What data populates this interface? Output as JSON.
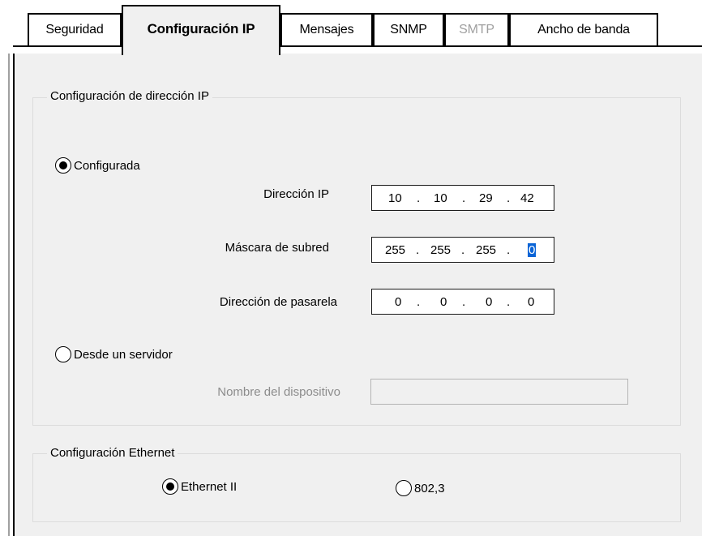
{
  "tabs": [
    {
      "label": "Seguridad",
      "active": false,
      "disabled": false
    },
    {
      "label": "Configuración IP",
      "active": true,
      "disabled": false
    },
    {
      "label": "Mensajes",
      "active": false,
      "disabled": false
    },
    {
      "label": "SNMP",
      "active": false,
      "disabled": false
    },
    {
      "label": "SMTP",
      "active": false,
      "disabled": true
    },
    {
      "label": "Ancho de banda",
      "active": false,
      "disabled": false
    }
  ],
  "ip_group": {
    "title": "Configuración de dirección IP",
    "radio_configured": {
      "label": "Configurada",
      "checked": true
    },
    "radio_server": {
      "label": "Desde un servidor",
      "checked": false
    },
    "ip_address": {
      "label": "Dirección IP",
      "octets": [
        "10",
        "10",
        "29",
        "42"
      ]
    },
    "subnet_mask": {
      "label": "Máscara de subred",
      "octets": [
        "255",
        "255",
        "255",
        "0"
      ],
      "selected_octet": 3
    },
    "gateway": {
      "label": "Dirección de pasarela",
      "octets": [
        "0",
        "0",
        "0",
        "0"
      ]
    },
    "device_name": {
      "label": "Nombre del dispositivo",
      "value": ""
    }
  },
  "ethernet_group": {
    "title": "Configuración Ethernet",
    "radio_ethernet2": {
      "label": "Ethernet II",
      "checked": true
    },
    "radio_8023": {
      "label": "802,3",
      "checked": false
    }
  },
  "separator": "."
}
